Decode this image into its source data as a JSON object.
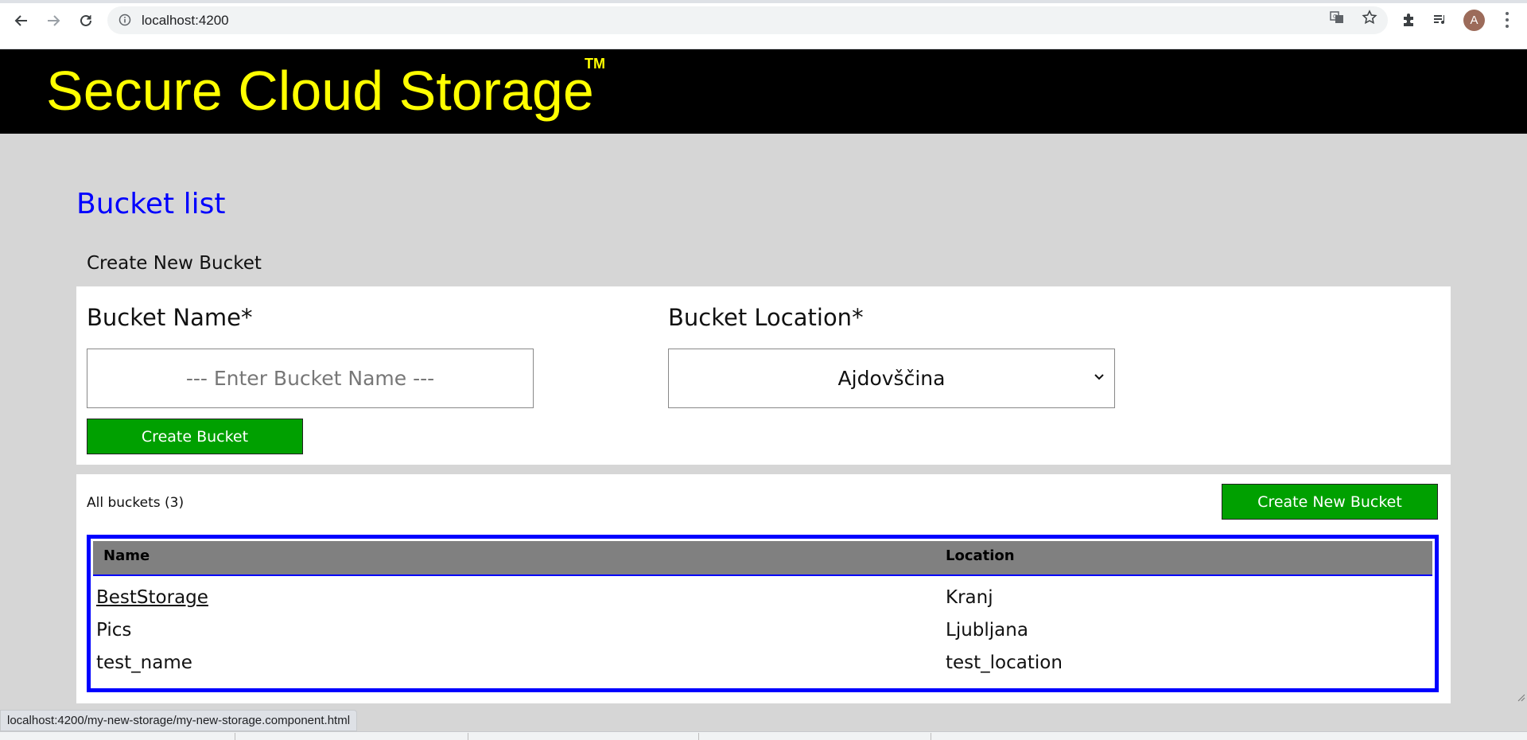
{
  "browser": {
    "url": "localhost:4200",
    "status_url": "localhost:4200/my-new-storage/my-new-storage.component.html",
    "avatar_initial": "A"
  },
  "header": {
    "title": "Secure Cloud Storage",
    "trademark": "TM"
  },
  "page": {
    "heading": "Bucket list",
    "create_label": "Create New Bucket"
  },
  "form": {
    "name_label": "Bucket Name*",
    "name_placeholder": "--- Enter Bucket Name ---",
    "location_label": "Bucket Location*",
    "location_selected": "Ajdovščina",
    "submit_label": "Create Bucket"
  },
  "list": {
    "count_label": "All buckets (3)",
    "create_new_label": "Create New Bucket",
    "columns": [
      "Name",
      "Location"
    ],
    "rows": [
      {
        "name": "BestStorage",
        "location": "Kranj"
      },
      {
        "name": "Pics",
        "location": "Ljubljana"
      },
      {
        "name": "test_name",
        "location": "test_location"
      }
    ]
  },
  "colors": {
    "header_bg": "#000000",
    "title_color": "#ffff00",
    "heading_color": "#0000ff",
    "button_green": "#00a000",
    "table_border": "#0000ff",
    "table_header_bg": "#808080"
  }
}
